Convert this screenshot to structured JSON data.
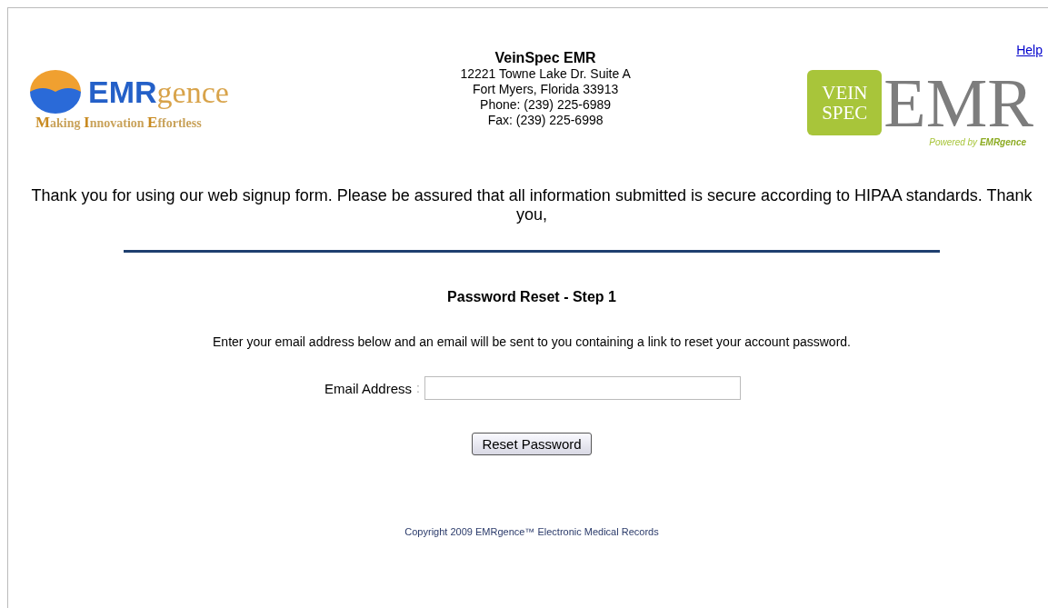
{
  "help_link": "Help",
  "left_logo": {
    "brand_bold": "EMR",
    "brand_rest": "gence",
    "tagline": "**M**aking **I**nnovation **E**ffortless"
  },
  "office": {
    "name": "VeinSpec EMR",
    "lines": [
      "12221 Towne Lake Dr. Suite A",
      "Fort Myers, Florida 33913",
      "Phone: (239) 225-6989",
      "Fax: (239) 225-6998"
    ]
  },
  "right_logo": {
    "badge_lines": [
      "VEIN",
      "SPEC"
    ],
    "word": "EMR",
    "powered": "Powered by **EMRgence**"
  },
  "notice": "Thank you for using our web signup form. Please be assured that all information submitted is secure according to HIPAA standards. Thank you,",
  "form": {
    "title": "Password Reset - Step 1",
    "instructions": "Enter your email address below and an email will be sent to you containing a link to reset your account password.",
    "email_label": "Email Address",
    "label_separator": ":",
    "button": "Reset Password"
  },
  "copyright": "Copyright 2009 EMRgence™ Electronic Medical Records"
}
